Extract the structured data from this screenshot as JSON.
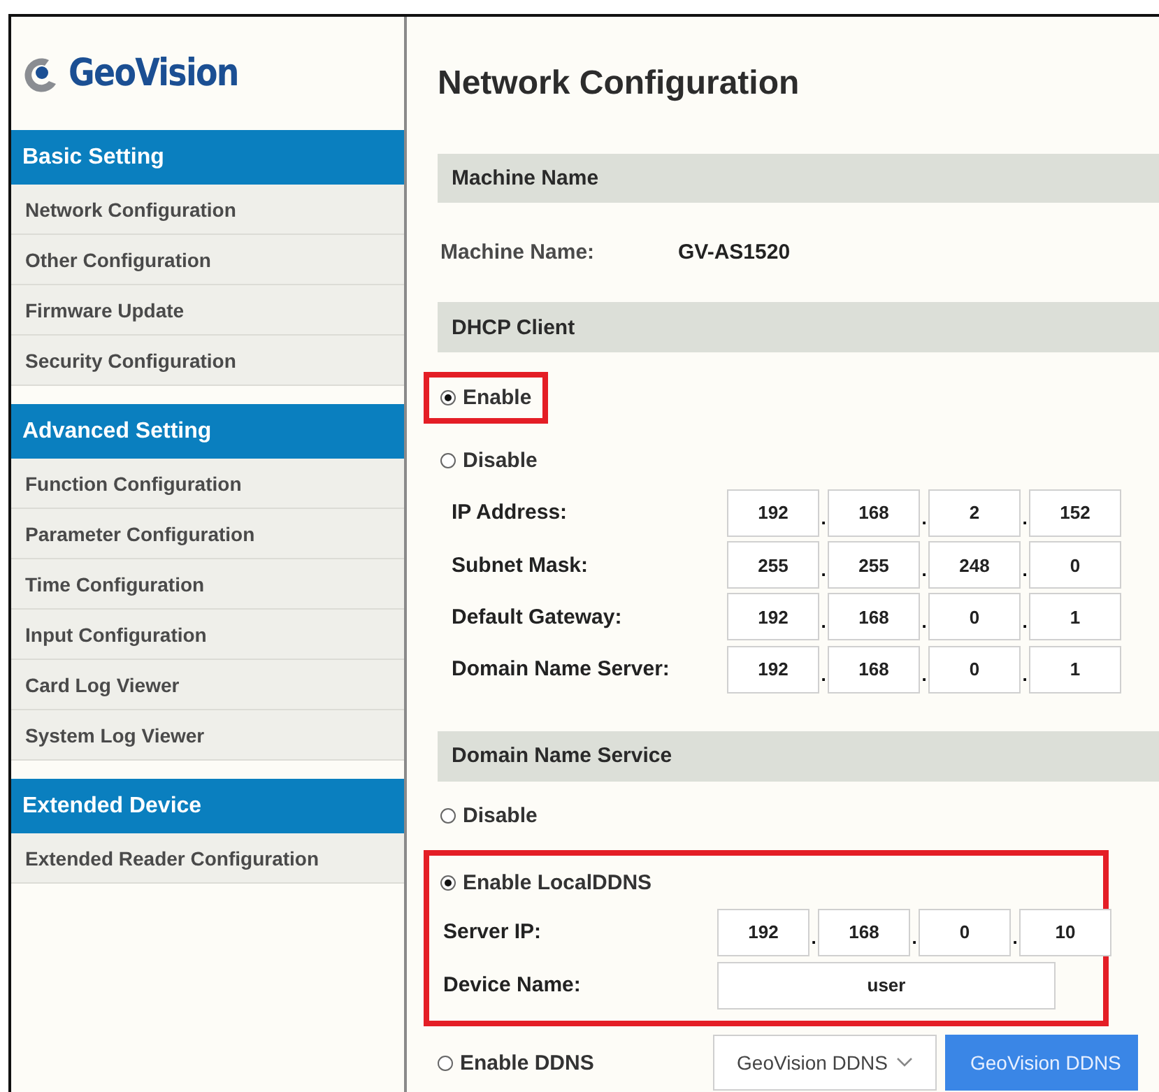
{
  "logo": {
    "text": "GeoVision"
  },
  "sidebar": {
    "groups": [
      {
        "title": "Basic Setting",
        "items": [
          {
            "label": "Network Configuration",
            "selected": false
          },
          {
            "label": "Other Configuration",
            "selected": false
          },
          {
            "label": "Firmware Update",
            "selected": false
          },
          {
            "label": "Security Configuration",
            "selected": false
          }
        ]
      },
      {
        "title": "Advanced Setting",
        "items": [
          {
            "label": "Function Configuration",
            "selected": false
          },
          {
            "label": "Parameter Configuration",
            "selected": false
          },
          {
            "label": "Time Configuration",
            "selected": false
          },
          {
            "label": "Input Configuration",
            "selected": false
          },
          {
            "label": "Card Log Viewer",
            "selected": false
          },
          {
            "label": "System Log Viewer",
            "selected": false
          }
        ]
      },
      {
        "title": "Extended Device",
        "items": [
          {
            "label": "Extended Reader Configuration",
            "selected": false
          }
        ]
      }
    ]
  },
  "page_title": "Network Configuration",
  "machine": {
    "header": "Machine Name",
    "label": "Machine Name:",
    "value": "GV-AS1520"
  },
  "dhcp": {
    "header": "DHCP Client",
    "options": [
      {
        "label": "Enable",
        "selected": true,
        "highlighted": true
      },
      {
        "label": "Disable",
        "selected": false,
        "highlighted": false
      }
    ],
    "fields": [
      {
        "label": "IP Address:",
        "octets": [
          "192",
          "168",
          "2",
          "152"
        ],
        "separators": [
          ".",
          ".",
          "."
        ]
      },
      {
        "label": "Subnet Mask:",
        "octets": [
          "255",
          "255",
          "248",
          "0"
        ],
        "separators": [
          ".",
          ".",
          "."
        ]
      },
      {
        "label": "Default Gateway:",
        "octets": [
          "192",
          "168",
          "0",
          "1"
        ],
        "separators": [
          ".",
          ".",
          "."
        ]
      },
      {
        "label": "Domain Name Server:",
        "octets": [
          "192",
          "168",
          "0",
          "1"
        ],
        "separators": [
          ".",
          ".",
          "."
        ]
      }
    ]
  },
  "dns": {
    "header": "Domain Name Service",
    "disable": {
      "label": "Disable",
      "selected": false
    },
    "local": {
      "label": "Enable LocalDDNS",
      "selected": true,
      "highlighted": true,
      "server_ip": {
        "label": "Server IP:",
        "octets": [
          "192",
          "168",
          "0",
          "10"
        ],
        "separators": [
          ".",
          ".",
          "."
        ]
      },
      "device_name": {
        "label": "Device Name:",
        "value": "user"
      }
    },
    "ddns": {
      "label": "Enable DDNS",
      "selected": false,
      "provider": "GeoVision DDNS",
      "button": "GeoVision DDNS"
    }
  }
}
